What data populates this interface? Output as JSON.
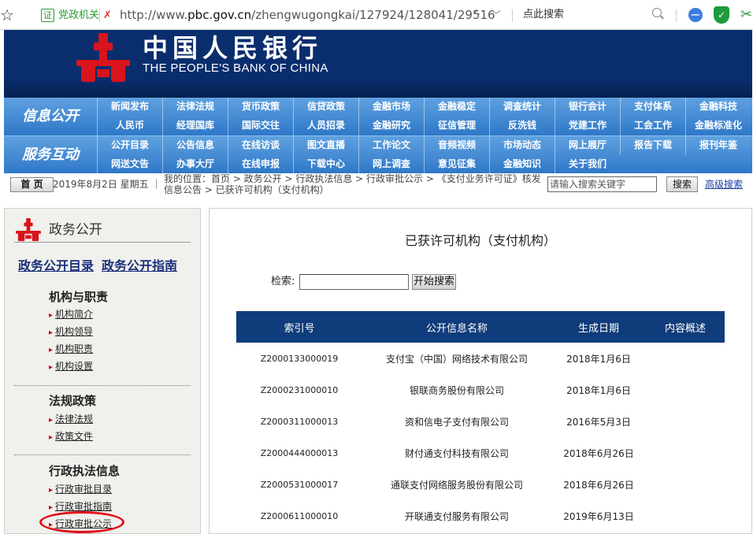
{
  "browser": {
    "zone_badge": "证",
    "zone_label": "党政机关",
    "url_prefix": "http://www.",
    "url_domain": "pbc.gov.cn",
    "url_path": "/zhengwugongkai/127924/128041/29516",
    "search_placeholder": "点此搜索"
  },
  "banner": {
    "title_cn": "中国人民银行",
    "title_en": "THE PEOPLE'S BANK OF CHINA"
  },
  "nav": {
    "info": {
      "category": "信息公开",
      "row1": [
        "新闻发布",
        "法律法规",
        "货币政策",
        "信贷政策",
        "金融市场",
        "金融稳定",
        "调查统计",
        "银行会计",
        "支付体系",
        "金融科技"
      ],
      "row2": [
        "人民币",
        "经理国库",
        "国际交往",
        "人员招录",
        "金融研究",
        "征信管理",
        "反洗钱",
        "党建工作",
        "工会工作",
        "金融标准化"
      ]
    },
    "service": {
      "category": "服务互动",
      "row1": [
        "公开目录",
        "公告信息",
        "在线访谈",
        "图文直播",
        "工作论文",
        "音频视频",
        "市场动态",
        "网上展厅",
        "报告下载",
        "报刊年鉴"
      ],
      "row2": [
        "网送文告",
        "办事大厅",
        "在线申报",
        "下载中心",
        "网上调查",
        "意见征集",
        "金融知识",
        "关于我们"
      ]
    }
  },
  "crumb": {
    "home": "首 页",
    "date": "2019年8月2日 星期五 ｜",
    "path": "我的位置：首页 > 政务公开 > 行政执法信息 > 行政审批公示 > 《支付业务许可证》核发信息公告 > 已获许可机构（支付机构）",
    "search_placeholder": "请输入搜索关键字",
    "search_button": "搜索",
    "advanced": "高级搜索"
  },
  "sidebar": {
    "title": "政务公开",
    "link1": "政务公开目录",
    "link2": "政务公开指南",
    "sections": [
      {
        "heading": "机构与职责",
        "items": [
          "机构简介",
          "机构领导",
          "机构职责",
          "机构设置"
        ]
      },
      {
        "heading": "法规政策",
        "items": [
          "法律法规",
          "政策文件"
        ]
      },
      {
        "heading": "行政执法信息",
        "items": [
          "行政审批目录",
          "行政审批指南",
          "行政审批公示"
        ]
      }
    ]
  },
  "main": {
    "title": "已获许可机构（支付机构）",
    "filter_label": "检索:",
    "filter_value": "",
    "filter_button": "开始搜索",
    "columns": [
      "索引号",
      "公开信息名称",
      "生成日期",
      "内容概述"
    ],
    "rows": [
      [
        "Z2000133000019",
        "支付宝（中国）网络技术有限公司",
        "2018年1月6日",
        ""
      ],
      [
        "Z2000231000010",
        "银联商务股份有限公司",
        "2018年1月6日",
        ""
      ],
      [
        "Z2000311000013",
        "资和信电子支付有限公司",
        "2016年5月3日",
        ""
      ],
      [
        "Z2000444000013",
        "财付通支付科技有限公司",
        "2018年6月26日",
        ""
      ],
      [
        "Z2000531000017",
        "通联支付网络服务股份有限公司",
        "2018年6月26日",
        ""
      ],
      [
        "Z2000611000010",
        "开联通支付服务有限公司",
        "2019年6月13日",
        ""
      ]
    ]
  },
  "colors": {
    "banner_bg": "#0a2d6e",
    "nav_blue": "#2f78c8",
    "table_header": "#0f3c7a",
    "highlight_red": "#e0101a"
  }
}
